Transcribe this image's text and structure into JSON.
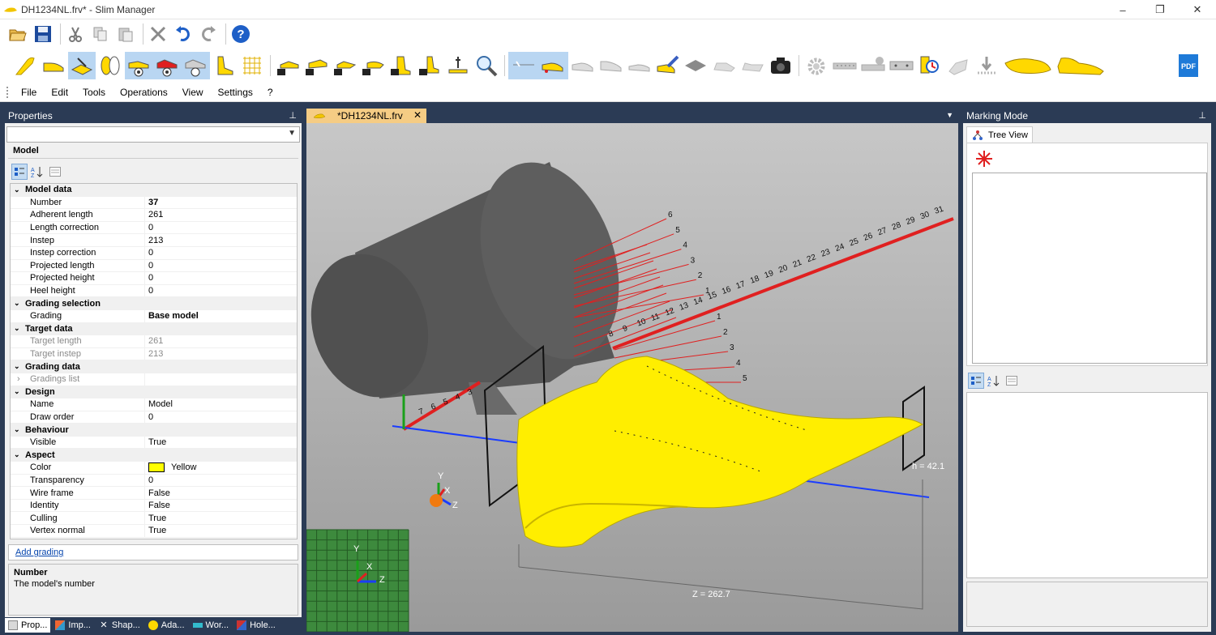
{
  "window": {
    "title": "DH1234NL.frv* - Slim Manager",
    "controls": {
      "minimize": "–",
      "maximize": "❐",
      "close": "✕"
    }
  },
  "menu": [
    "File",
    "Edit",
    "Tools",
    "Operations",
    "View",
    "Settings",
    "?"
  ],
  "properties_panel": {
    "title": "Properties",
    "pin": "📌",
    "section": "Model",
    "rows": [
      {
        "kind": "cat",
        "name": "Model data"
      },
      {
        "kind": "prop",
        "name": "Number",
        "value": "37",
        "bold": true
      },
      {
        "kind": "prop",
        "name": "Adherent length",
        "value": "261"
      },
      {
        "kind": "prop",
        "name": "Length correction",
        "value": "0"
      },
      {
        "kind": "prop",
        "name": "Instep",
        "value": "213"
      },
      {
        "kind": "prop",
        "name": "Instep correction",
        "value": "0"
      },
      {
        "kind": "prop",
        "name": "Projected length",
        "value": "0"
      },
      {
        "kind": "prop",
        "name": "Projected height",
        "value": "0"
      },
      {
        "kind": "prop",
        "name": "Heel height",
        "value": "0"
      },
      {
        "kind": "cat",
        "name": "Grading selection"
      },
      {
        "kind": "prop",
        "name": "Grading",
        "value": "Base model",
        "bold": true
      },
      {
        "kind": "cat",
        "name": "Target data"
      },
      {
        "kind": "prop",
        "name": "Target length",
        "value": "261",
        "dim": true
      },
      {
        "kind": "prop",
        "name": "Target instep",
        "value": "213",
        "dim": true
      },
      {
        "kind": "cat",
        "name": "Grading data"
      },
      {
        "kind": "prop",
        "name": "Gradings list",
        "value": "",
        "dim": true,
        "collapsed": true
      },
      {
        "kind": "cat",
        "name": "Design"
      },
      {
        "kind": "prop",
        "name": "Name",
        "value": "Model"
      },
      {
        "kind": "prop",
        "name": "Draw order",
        "value": "0"
      },
      {
        "kind": "cat",
        "name": "Behaviour"
      },
      {
        "kind": "prop",
        "name": "Visible",
        "value": "True"
      },
      {
        "kind": "cat",
        "name": "Aspect"
      },
      {
        "kind": "prop",
        "name": "Color",
        "value": "Yellow",
        "swatch": "#ffff00"
      },
      {
        "kind": "prop",
        "name": "Transparency",
        "value": "0"
      },
      {
        "kind": "prop",
        "name": "Wire frame",
        "value": "False"
      },
      {
        "kind": "prop",
        "name": "Identity",
        "value": "False"
      },
      {
        "kind": "prop",
        "name": "Culling",
        "value": "True"
      },
      {
        "kind": "prop",
        "name": "Vertex normal",
        "value": "True"
      }
    ],
    "add_grading_link": "Add grading",
    "description": {
      "title": "Number",
      "text": "The model's number"
    }
  },
  "bottom_tabs": [
    "Prop...",
    "Imp...",
    "Shap...",
    "Ada...",
    "Wor...",
    "Hole..."
  ],
  "document_tab": {
    "label": "*DH1234NL.frv",
    "close": "✕"
  },
  "viewport": {
    "measure_height": "h = 42.1",
    "measure_z": "Z = 262.7",
    "axis_labels": {
      "x": "X",
      "y": "Y",
      "z": "Z"
    },
    "ruler_long": [
      "31",
      "30",
      "29",
      "28",
      "27",
      "26",
      "25",
      "24",
      "23",
      "22",
      "21",
      "20",
      "19",
      "18",
      "17",
      "16",
      "15",
      "14",
      "13",
      "12",
      "11",
      "10",
      "9",
      "8"
    ],
    "ruler_short": [
      "7",
      "6",
      "5",
      "4",
      "3"
    ],
    "fan_upper": [
      "6",
      "5",
      "4",
      "3",
      "2",
      "1"
    ],
    "fan_lower": [
      "1",
      "2",
      "3",
      "4",
      "5"
    ],
    "colors": {
      "last": "#ffee00",
      "cylinder": "#5a5a5a",
      "ruler": "#e02020",
      "axis_blue": "#1a3cff",
      "grid": "#2f7a2f"
    }
  },
  "marking_panel": {
    "title": "Marking Mode",
    "pin": "📌",
    "tab": "Tree View"
  }
}
